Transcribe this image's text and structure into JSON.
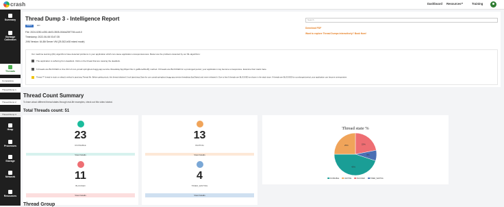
{
  "brand": {
    "logo_word": "crash"
  },
  "topnav": {
    "dashboard": "Dashboard",
    "resources": "Resources",
    "training": "Training"
  },
  "sidebar": {
    "items": [
      {
        "label": "Summary"
      },
      {
        "label": "Garbage Collection"
      },
      {
        "label": "Threads"
      },
      {
        "label": "Heap"
      },
      {
        "label": "Processes"
      },
      {
        "label": "Storage"
      },
      {
        "label": "Network"
      },
      {
        "label": "Resources"
      }
    ],
    "subitems": [
      "Comparative summary",
      "Thread Dump 1",
      "Thread Dump 2",
      "Thread Dump 3"
    ]
  },
  "report": {
    "title": "Thread Dump 3 - Intelligence Report",
    "badges": [
      "Follow",
      "Edit"
    ],
    "file": "File: 2024-0250-e252-4b03-3505-0044d25f7745.conf-0",
    "timestamp": "Timestamp: 2022-06-08 03:47:35",
    "jvm": "JVM Version: 64-Bit Server VM (25.302-b08 mixed mode)",
    "search_placeholder": "Search",
    "download_pdf": "Download PDF",
    "explore_link": "Want to explore Thread Dumps interactively? Book Now!"
  },
  "notes": {
    "intro": "Our machine learning (ML) algorithms have detected problems in your application which can cause application unresponsiveness. Below are the problems detected by our ML algorithms:",
    "items": [
      "The application is suffering from deadlock. Click on the thread that are causing the deadlock.",
      "6 threads are BLOCKED on line 313 of com.yoradr.springboot.buggy.app.service.threadstay.SpyObject file in getBoredStuff() method. If threads are BLOCKED for a prolonged period, your application may become unresponsive. Examine their stack trace.",
      "Thread 'T' thread is stuck on sleep() method in java.lang.Thread file. Before getting stuck, this thread obtained 1 lock (java.lang.Class for com.yoradr.springboot.buggy.app.service.threadstay.SpyObject) and never released it. Due to that 6 threads are BLOCKED as shown in the stack trace. If threads are BLOCKED for a prolonged period, your application can become unresponsive."
    ]
  },
  "summary": {
    "title": "Thread Count Summary",
    "subtitle": "To learn about different thread states through real-life examples, check out this video tutorial.",
    "total": "Total Threads count: 51",
    "cards": [
      {
        "count": "23",
        "label": "RUNNABLE",
        "button": "View Details",
        "color": "#1abc9c",
        "btn_bg": "#d7f2ee"
      },
      {
        "count": "13",
        "label": "WAITING",
        "button": "View Details",
        "color": "#f0a45a",
        "btn_bg": "#fde8d7"
      },
      {
        "count": "11",
        "label": "BLOCKED",
        "button": "View Details",
        "color": "#ee6e73",
        "btn_bg": "#fcdede"
      },
      {
        "count": "4",
        "label": "TIMED_WAITING",
        "button": "View Details",
        "color": "#7aa7d6",
        "btn_bg": "#cfe0f1"
      }
    ]
  },
  "chart_data": {
    "type": "pie",
    "title": "Thread state %",
    "series": [
      {
        "name": "RUNNABLE",
        "value": 45,
        "label": "45%",
        "color": "#1a9e96"
      },
      {
        "name": "WAITING",
        "value": 25,
        "label": "25%",
        "color": "#f0a45a"
      },
      {
        "name": "BLOCKED",
        "value": 22,
        "label": "22%",
        "color": "#ee6e73"
      },
      {
        "name": "TIMED_WAITING",
        "value": 8,
        "label": "8%",
        "color": "#4a6fb3"
      }
    ]
  },
  "next_section": {
    "title": "Thread Group"
  }
}
